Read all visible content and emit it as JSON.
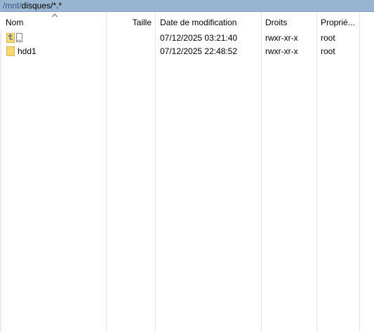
{
  "pathbar": {
    "prefix": "/mnt/",
    "current": "disques/*.*"
  },
  "columns": {
    "name": "Nom",
    "size": "Taille",
    "modified": "Date de modification",
    "rights": "Droits",
    "owner": "Propriétaire",
    "owner_display": "Proprié..."
  },
  "rows": [
    {
      "icon": "parent-folder-icon",
      "name": "..",
      "size": "",
      "modified": "07/12/2025 03:21:40",
      "rights": "rwxr-xr-x",
      "owner": "root"
    },
    {
      "icon": "folder-icon",
      "name": "hdd1",
      "size": "",
      "modified": "07/12/2025 22:48:52",
      "rights": "rwxr-xr-x",
      "owner": "root"
    }
  ],
  "colors": {
    "pathbar_bg": "#99b4d1",
    "folder_fill": "#f8d775",
    "folder_edge": "#dcb449",
    "parent_arrow": "#3b6ea5"
  }
}
